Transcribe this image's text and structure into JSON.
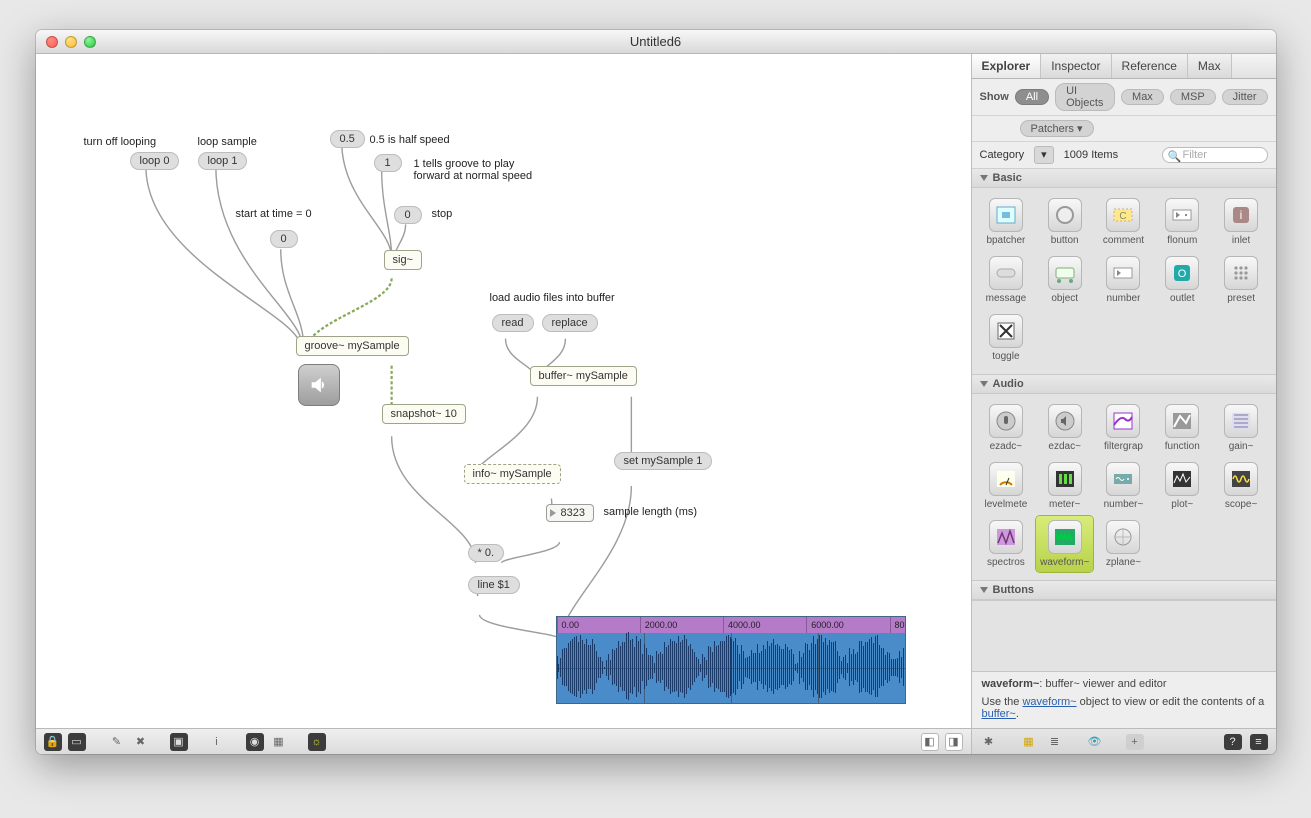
{
  "window": {
    "title": "Untitled6"
  },
  "patcher": {
    "comments": {
      "turn_off": "turn off looping",
      "loop_sample": "loop sample",
      "half_speed": "0.5 is half speed",
      "tells_groove": "1 tells groove to play\nforward at normal speed",
      "start_at": "start at time = 0",
      "stop": "stop",
      "load_files": "load audio files into buffer",
      "sample_len": "sample length (ms)"
    },
    "messages": {
      "loop0": "loop 0",
      "loop1": "loop 1",
      "val_05": "0.5",
      "val_1": "1",
      "val_0_1": "0",
      "val_0_2": "0",
      "read": "read",
      "replace": "replace",
      "set_mysample": "set mySample 1",
      "times": "* 0.",
      "line": "line $1"
    },
    "objects": {
      "sig": "sig~",
      "groove": "groove~ mySample",
      "snapshot": "snapshot~ 10",
      "buffer": "buffer~ mySample",
      "info": "info~ mySample"
    },
    "numbers": {
      "sample_ms": "8323"
    },
    "waveform": {
      "ticks": [
        "0.00",
        "2000.00",
        "4000.00",
        "6000.00",
        "80"
      ]
    }
  },
  "sidebar": {
    "tabs": [
      "Explorer",
      "Inspector",
      "Reference",
      "Max"
    ],
    "show_label": "Show",
    "show_pills": [
      "All",
      "UI Objects",
      "Max",
      "MSP",
      "Jitter",
      "Patchers ▾"
    ],
    "category_label": "Category",
    "item_count": "1009 Items",
    "filter_placeholder": "Filter",
    "sections": {
      "basic": {
        "title": "Basic",
        "items": [
          "bpatcher",
          "button",
          "comment",
          "flonum",
          "inlet",
          "message",
          "object",
          "number",
          "outlet",
          "preset",
          "toggle"
        ]
      },
      "audio": {
        "title": "Audio",
        "items": [
          "ezadc~",
          "ezdac~",
          "filtergrap",
          "function",
          "gain~",
          "levelmete",
          "meter~",
          "number~",
          "plot~",
          "scope~",
          "spectros",
          "waveform~",
          "zplane~"
        ]
      },
      "buttons": {
        "title": "Buttons"
      }
    },
    "help": {
      "title_bold": "waveform~",
      "title_rest": ": buffer~ viewer and editor",
      "body_pre": "Use the ",
      "link1": "waveform~",
      "body_mid": " object to view or edit the contents of a ",
      "link2": "buffer~",
      "body_post": "."
    }
  }
}
